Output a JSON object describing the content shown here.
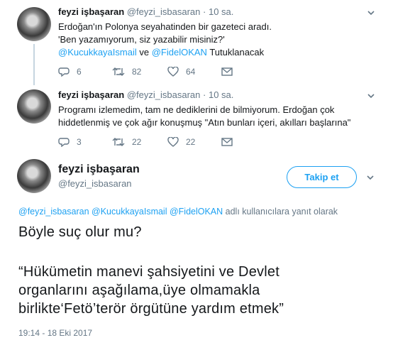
{
  "tweets": [
    {
      "name": "feyzi işbaşaran",
      "handle": "@feyzi_isbasaran",
      "dot": "·",
      "time": "10 sa.",
      "lines": [
        "Erdoğan'ın Polonya seyahatinden bir gazeteci aradı.",
        "'Ben yazamıyorum, siz yazabilir misiniz?'"
      ],
      "mention1": "@KucukkayaIsmail",
      "conj": " ve ",
      "mention2": "@FidelOKAN",
      "tail": " Tutuklanacak",
      "replies": "6",
      "retweets": "82",
      "likes": "64"
    },
    {
      "name": "feyzi işbaşaran",
      "handle": "@feyzi_isbasaran",
      "dot": "·",
      "time": "10 sa.",
      "lines": [
        "Programı izlemedim, tam ne dediklerini de bilmiyorum. Erdoğan çok",
        "hiddetlenmiş ve çok ağır konuşmuş \"Atın bunları içeri, akılları başlarına\""
      ],
      "replies": "3",
      "retweets": "22",
      "likes": "22"
    }
  ],
  "main": {
    "name": "feyzi işbaşaran",
    "handle": "@feyzi_isbasaran",
    "follow_label": "Takip et",
    "reply_mentions": "@feyzi_isbasaran @KucukkayaIsmail @FidelOKAN",
    "reply_suffix": " adlı kullanıcılara yanıt olarak",
    "text_lines": [
      "Böyle suç olur mu?",
      "",
      "“Hükümetin manevi şahsiyetini ve Devlet",
      "organlarını aşağılama,üye olmamakla",
      "birlikte‘Fetö’terör örgütüne yardım etmek”"
    ],
    "timestamp": "19:14 - 18 Eki 2017"
  },
  "colors": {
    "accent": "#1da1f2",
    "muted": "#657786",
    "thread_line": "#c6d5e0"
  },
  "icons": [
    "reply-icon",
    "retweet-icon",
    "like-icon",
    "dm-icon",
    "chevron-down-icon"
  ]
}
